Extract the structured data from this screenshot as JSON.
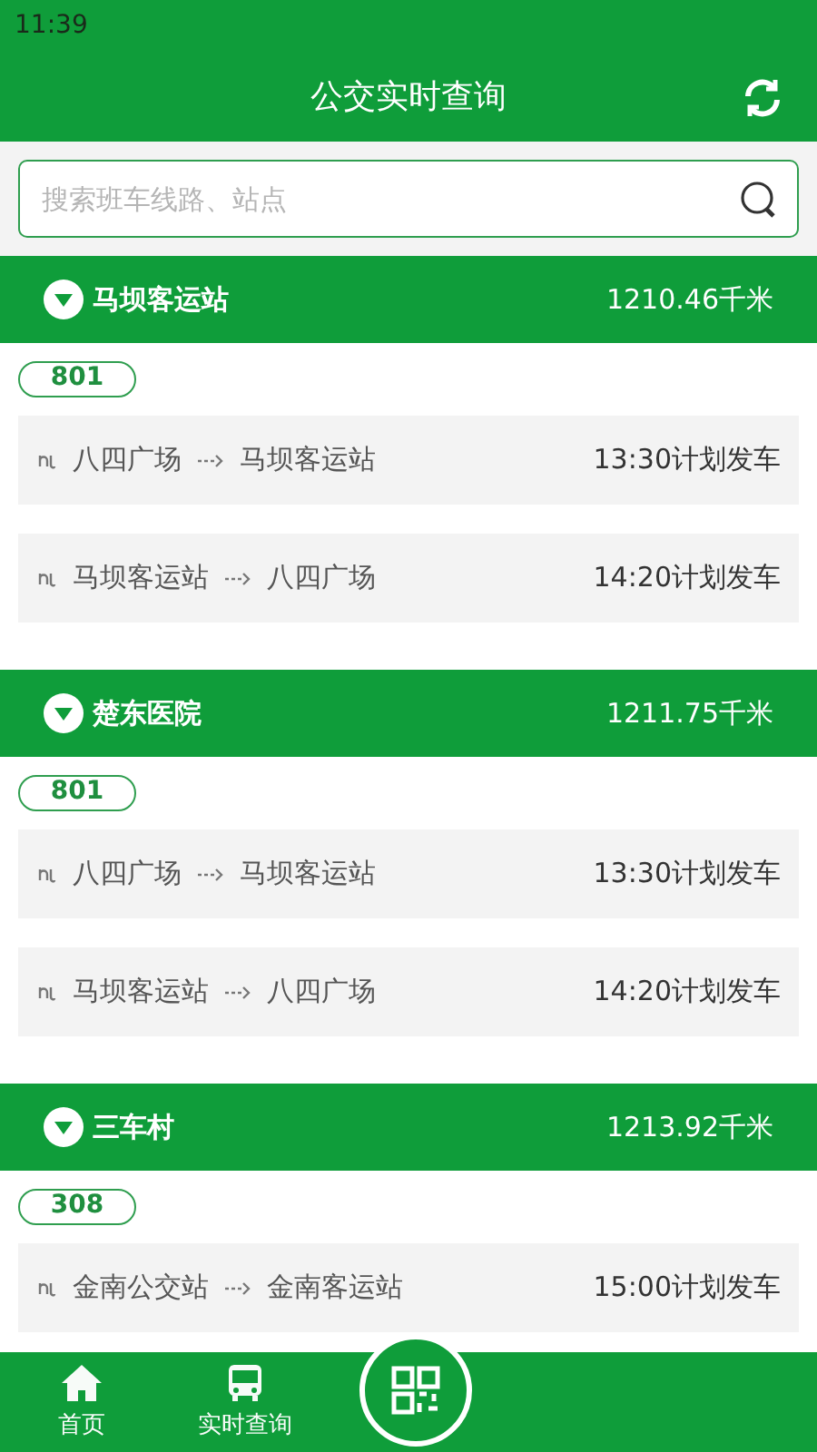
{
  "status_bar": {
    "time": "11:39"
  },
  "header": {
    "title": "公交实时查询"
  },
  "search": {
    "placeholder": "搜索班车线路、站点"
  },
  "stations": [
    {
      "name": "马坝客运站",
      "distance": "1210.46千米",
      "expanded": true,
      "routes": [
        {
          "line": "801",
          "trips": [
            {
              "from": "八四广场",
              "to": "马坝客运站",
              "time": "13:30计划发车"
            },
            {
              "from": "马坝客运站",
              "to": "八四广场",
              "time": "14:20计划发车"
            }
          ]
        }
      ]
    },
    {
      "name": "楚东医院",
      "distance": "1211.75千米",
      "expanded": true,
      "routes": [
        {
          "line": "801",
          "trips": [
            {
              "from": "八四广场",
              "to": "马坝客运站",
              "time": "13:30计划发车"
            },
            {
              "from": "马坝客运站",
              "to": "八四广场",
              "time": "14:20计划发车"
            }
          ]
        }
      ]
    },
    {
      "name": "三车村",
      "distance": "1213.92千米",
      "expanded": true,
      "routes": [
        {
          "line": "308",
          "trips": [
            {
              "from": "金南公交站",
              "to": "金南客运站",
              "time": "15:00计划发车"
            }
          ]
        }
      ]
    }
  ],
  "nav": [
    {
      "kind": "home",
      "label": "首页",
      "selected": false
    },
    {
      "kind": "bus",
      "label": "实时查询",
      "selected": false
    },
    {
      "kind": "scan",
      "selected": false
    }
  ]
}
